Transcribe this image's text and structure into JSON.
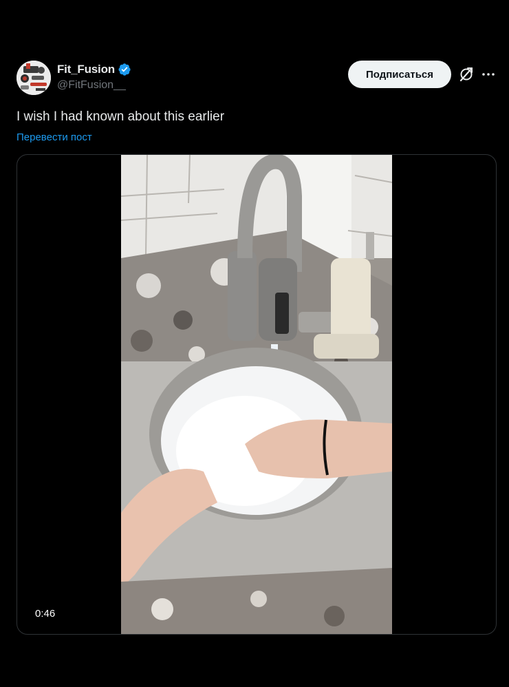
{
  "author": {
    "display_name": "Fit_Fusion",
    "handle": "@FitFusion__",
    "verified": true,
    "avatar_icon": "avatar-image"
  },
  "actions": {
    "subscribe_label": "Подписаться",
    "grok_icon": "grok-icon",
    "more_icon": "more-icon"
  },
  "post": {
    "text": "I wish I had known about this earlier",
    "translate_label": "Перевести пост"
  },
  "media": {
    "type": "video",
    "duration": "0:46"
  },
  "colors": {
    "background": "#000000",
    "text_primary": "#e7e9ea",
    "text_secondary": "#71767b",
    "link": "#1d9bf0",
    "verified_badge": "#1d9bf0",
    "button_bg": "#eff3f4",
    "border": "#2f3336"
  }
}
